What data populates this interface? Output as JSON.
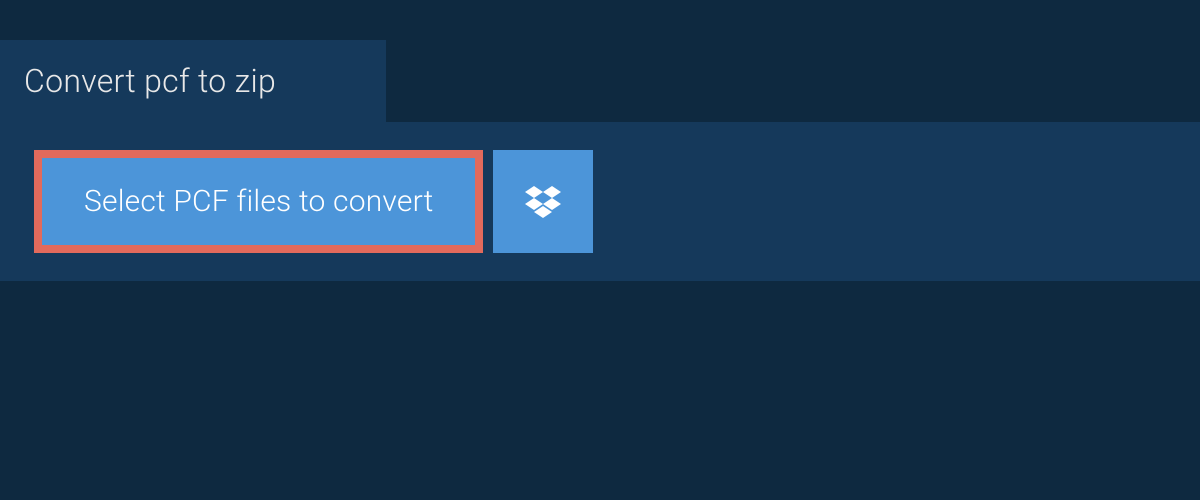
{
  "tab": {
    "title": "Convert pcf to zip"
  },
  "actions": {
    "select_label": "Select PCF files to convert",
    "dropbox_icon": "dropbox-icon"
  },
  "colors": {
    "background": "#0e2940",
    "panel": "#15395b",
    "button": "#4c95d9",
    "highlight_border": "#e26a5c",
    "text_light": "#ffffff"
  }
}
